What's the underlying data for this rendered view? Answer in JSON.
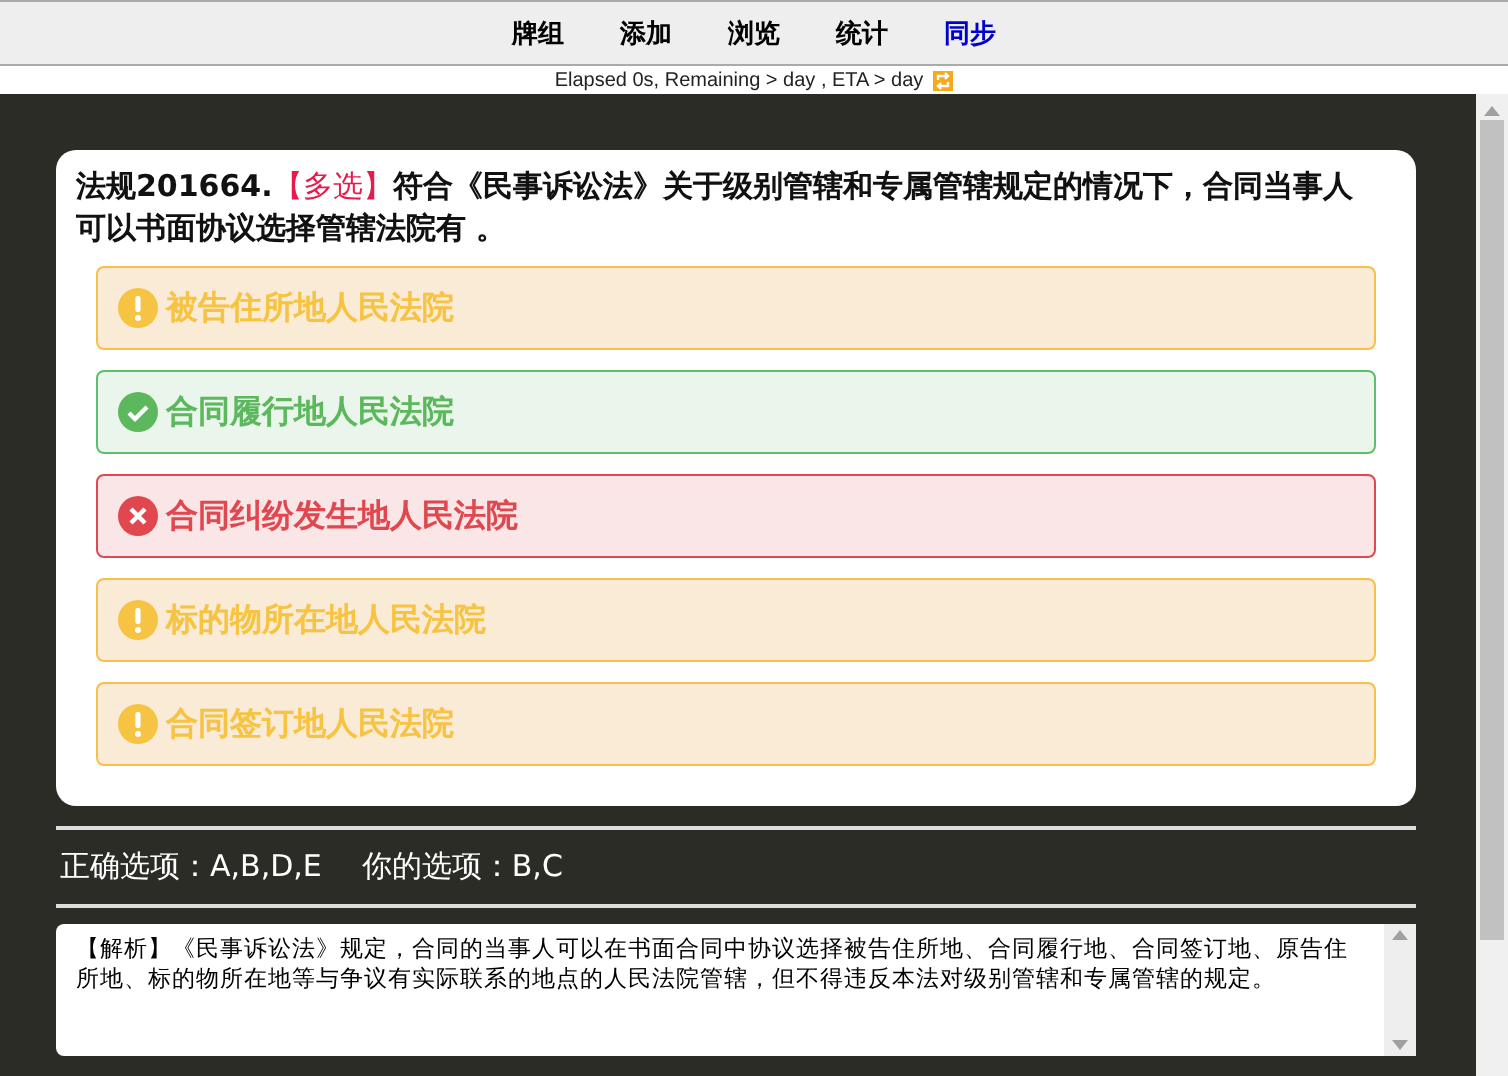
{
  "nav": [
    {
      "label": "牌组",
      "color": "#000000"
    },
    {
      "label": "添加",
      "color": "#000000"
    },
    {
      "label": "浏览",
      "color": "#000000"
    },
    {
      "label": "统计",
      "color": "#000000"
    },
    {
      "label": "同步",
      "color": "#0000cc"
    }
  ],
  "status": "Elapsed 0s, Remaining > day , ETA > day",
  "question": {
    "number": "法规201664.",
    "tag": "【多选】",
    "text": "符合《民事诉讼法》关于级别管辖和专属管辖规定的情况下，合同当事人可以书面协议选择管辖法院有 。"
  },
  "options": [
    {
      "label": "被告住所地人民法院",
      "kind": "missed"
    },
    {
      "label": "合同履行地人民法院",
      "kind": "correct"
    },
    {
      "label": "合同纠纷发生地人民法院",
      "kind": "wrong"
    },
    {
      "label": "标的物所在地人民法院",
      "kind": "missed"
    },
    {
      "label": "合同签订地人民法院",
      "kind": "missed"
    }
  ],
  "answer": {
    "correct": "正确选项：A,B,D,E",
    "yours": "你的选项：B,C"
  },
  "explanation": "【解析】《民事诉讼法》规定，合同的当事人可以在书面合同中协议选择被告住所地、合同履行地、合同签订地、原告住所地、标的物所在地等与争议有实际联系的地点的人民法院管辖，但不得违反本法对级别管辖和专属管辖的规定。"
}
